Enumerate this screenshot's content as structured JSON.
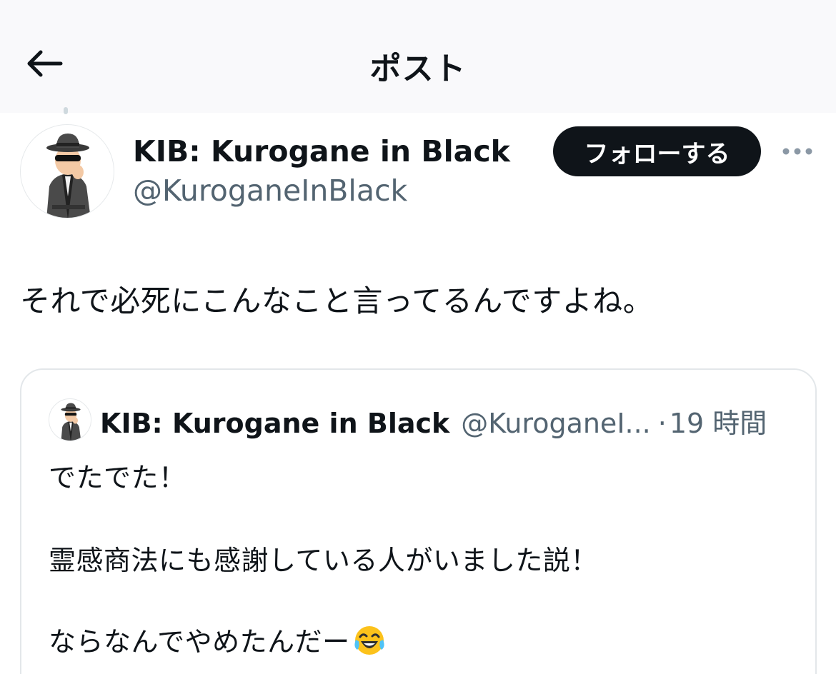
{
  "header": {
    "title": "ポスト",
    "back_icon": "arrow-left-icon"
  },
  "author": {
    "display_name": "KIB: Kurogane in Black",
    "handle": "@KuroganeInBlack",
    "avatar": "spy-in-trenchcoat-avatar"
  },
  "actions": {
    "follow_label": "フォローする",
    "more_icon": "more-horizontal-icon"
  },
  "tweet": {
    "text": "それで必死にこんなこと言ってるんですよね。"
  },
  "quote": {
    "display_name": "KIB: Kurogane in Black",
    "handle": "@KuroganeI...",
    "separator": "·",
    "time": "19 時間",
    "lines": [
      "でたでた！",
      "霊感商法にも感謝している人がいました説！",
      "ならなんでやめたんだー"
    ],
    "emoji": "face-with-tears-of-joy"
  },
  "colors": {
    "text_primary": "#0f1419",
    "text_secondary": "#536471",
    "border": "#e3e7ea",
    "header_bg": "#f9f9fb",
    "follow_bg": "#0f1419"
  }
}
